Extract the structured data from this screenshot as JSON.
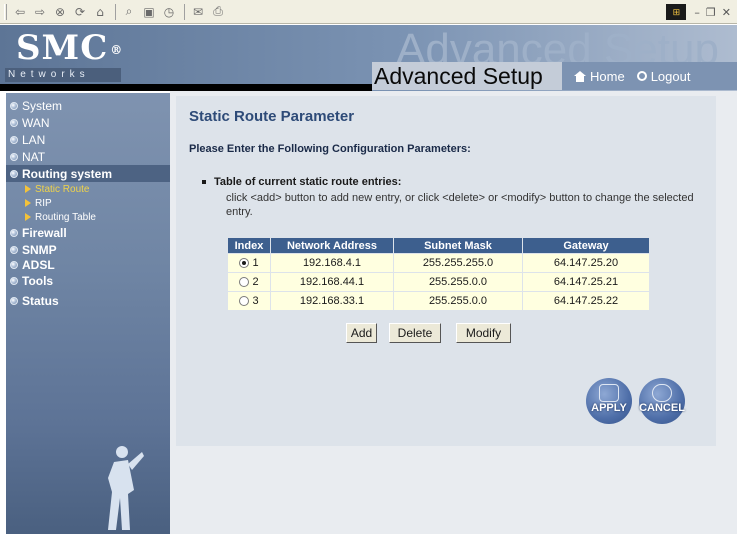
{
  "browser": {
    "toolbar_icons": [
      "back-arrow-icon",
      "forward-arrow-icon",
      "stop-icon",
      "refresh-icon",
      "home-icon",
      "search-icon",
      "favorites-icon",
      "history-icon",
      "mail-icon",
      "print-icon"
    ],
    "window_controls": [
      "minimize-icon",
      "restore-icon",
      "close-icon"
    ]
  },
  "banner": {
    "brand": "SMC",
    "registered_mark": "®",
    "brand_sub": "Networks",
    "watermark": "Advanced Setup",
    "title": "Advanced Setup",
    "home_label": "Home",
    "logout_label": "Logout"
  },
  "sidebar": {
    "items": [
      {
        "label": "System"
      },
      {
        "label": "WAN"
      },
      {
        "label": "LAN"
      },
      {
        "label": "NAT"
      },
      {
        "label": "Routing system"
      },
      {
        "label": "Firewall"
      },
      {
        "label": "SNMP"
      },
      {
        "label": "ADSL"
      },
      {
        "label": "Tools"
      },
      {
        "label": "Status"
      }
    ],
    "routing_sub": [
      {
        "label": "Static Route"
      },
      {
        "label": "RIP"
      },
      {
        "label": "Routing Table"
      }
    ]
  },
  "main": {
    "title": "Static Route Parameter",
    "instruction": "Please Enter the Following Configuration Parameters:",
    "section_title": "Table of current static route entries:",
    "section_desc": "click <add> button to add new entry, or click <delete> or <modify> button to change the selected entry.",
    "table": {
      "headers": [
        "Index",
        "Network Address",
        "Subnet Mask",
        "Gateway"
      ],
      "rows": [
        {
          "index": "1",
          "network": "192.168.4.1",
          "mask": "255.255.255.0",
          "gateway": "64.147.25.20",
          "selected": true
        },
        {
          "index": "2",
          "network": "192.168.44.1",
          "mask": "255.255.0.0",
          "gateway": "64.147.25.21",
          "selected": false
        },
        {
          "index": "3",
          "network": "192.168.33.1",
          "mask": "255.255.0.0",
          "gateway": "64.147.25.22",
          "selected": false
        }
      ]
    },
    "buttons": {
      "add": "Add",
      "delete": "Delete",
      "modify": "Modify",
      "apply": "APPLY",
      "cancel": "CANCEL"
    }
  }
}
